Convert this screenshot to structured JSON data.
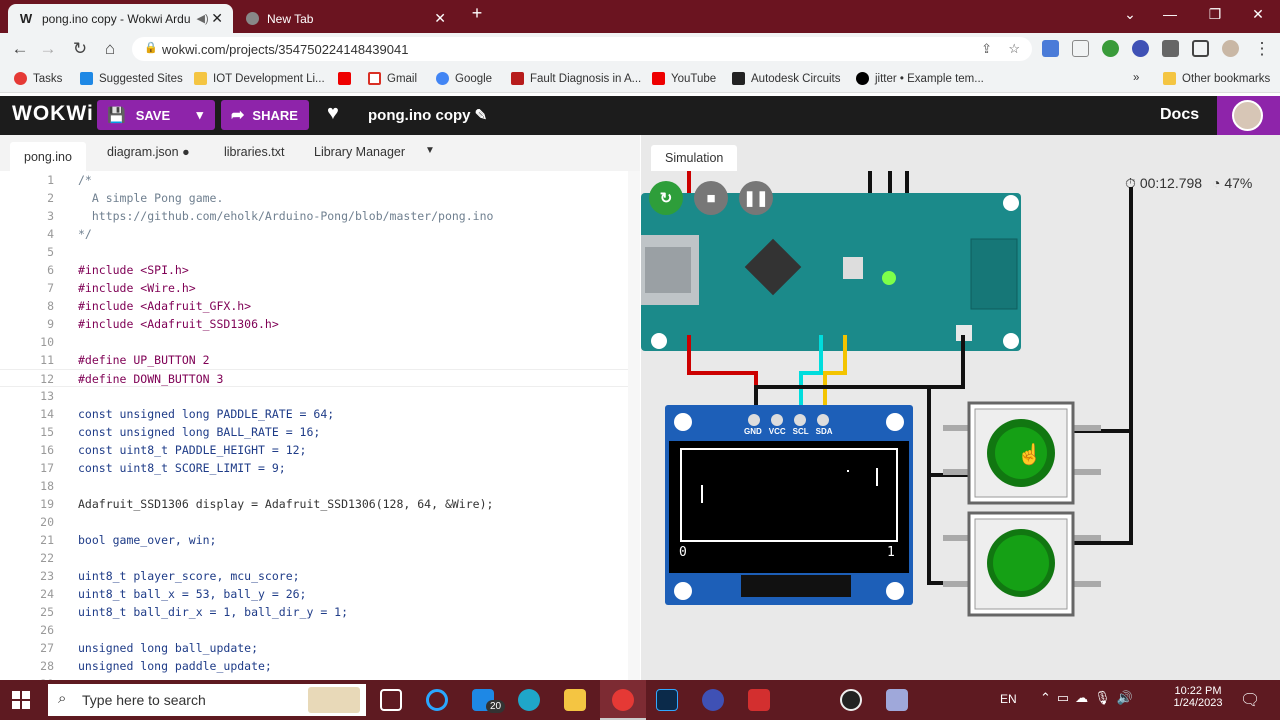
{
  "browser": {
    "tabs": [
      {
        "title": "pong.ino copy - Wokwi Ardu",
        "favicon": "W",
        "active": true
      },
      {
        "title": "New Tab",
        "active": false
      }
    ],
    "url": "wokwi.com/projects/354750224148439041",
    "bookmarks": [
      "Tasks",
      "Suggested Sites",
      "IOT Development Li...",
      "Gmail",
      "Google",
      "Fault Diagnosis in A...",
      "YouTube",
      "Autodesk Circuits",
      "jitter • Example tem..."
    ],
    "other_bookmarks": "Other bookmarks"
  },
  "wokwi": {
    "logo": "WOKWi",
    "save_label": "SAVE",
    "share_label": "SHARE",
    "project_name": "pong.ino copy",
    "docs_label": "Docs"
  },
  "editor": {
    "tabs": [
      "pong.ino",
      "diagram.json",
      "libraries.txt",
      "Library Manager"
    ],
    "lines": [
      "/*",
      "  A simple Pong game.",
      "  https://github.com/eholk/Arduino-Pong/blob/master/pong.ino",
      "*/",
      "",
      "#include <SPI.h>",
      "#include <Wire.h>",
      "#include <Adafruit_GFX.h>",
      "#include <Adafruit_SSD1306.h>",
      "",
      "#define UP_BUTTON 2",
      "#define DOWN_BUTTON 3",
      "",
      "const unsigned long PADDLE_RATE = 64;",
      "const unsigned long BALL_RATE = 16;",
      "const uint8_t PADDLE_HEIGHT = 12;",
      "const uint8_t SCORE_LIMIT = 9;",
      "",
      "Adafruit_SSD1306 display = Adafruit_SSD1306(128, 64, &Wire);",
      "",
      "bool game_over, win;",
      "",
      "uint8_t player_score, mcu_score;",
      "uint8_t ball_x = 53, ball_y = 26;",
      "uint8_t ball_dir_x = 1, ball_dir_y = 1;",
      "",
      "unsigned long ball_update;",
      "unsigned long paddle_update;",
      ""
    ]
  },
  "simulation": {
    "tab_label": "Simulation",
    "elapsed": "00:12.798",
    "speed": "47%",
    "oled_pins": [
      "GND",
      "VCC",
      "SCL",
      "SDA"
    ],
    "player_score": "0",
    "mcu_score": "1"
  },
  "taskbar": {
    "search_placeholder": "Type here to search",
    "mail_badge": "20",
    "language": "EN",
    "time": "10:22 PM",
    "date": "1/24/2023"
  }
}
